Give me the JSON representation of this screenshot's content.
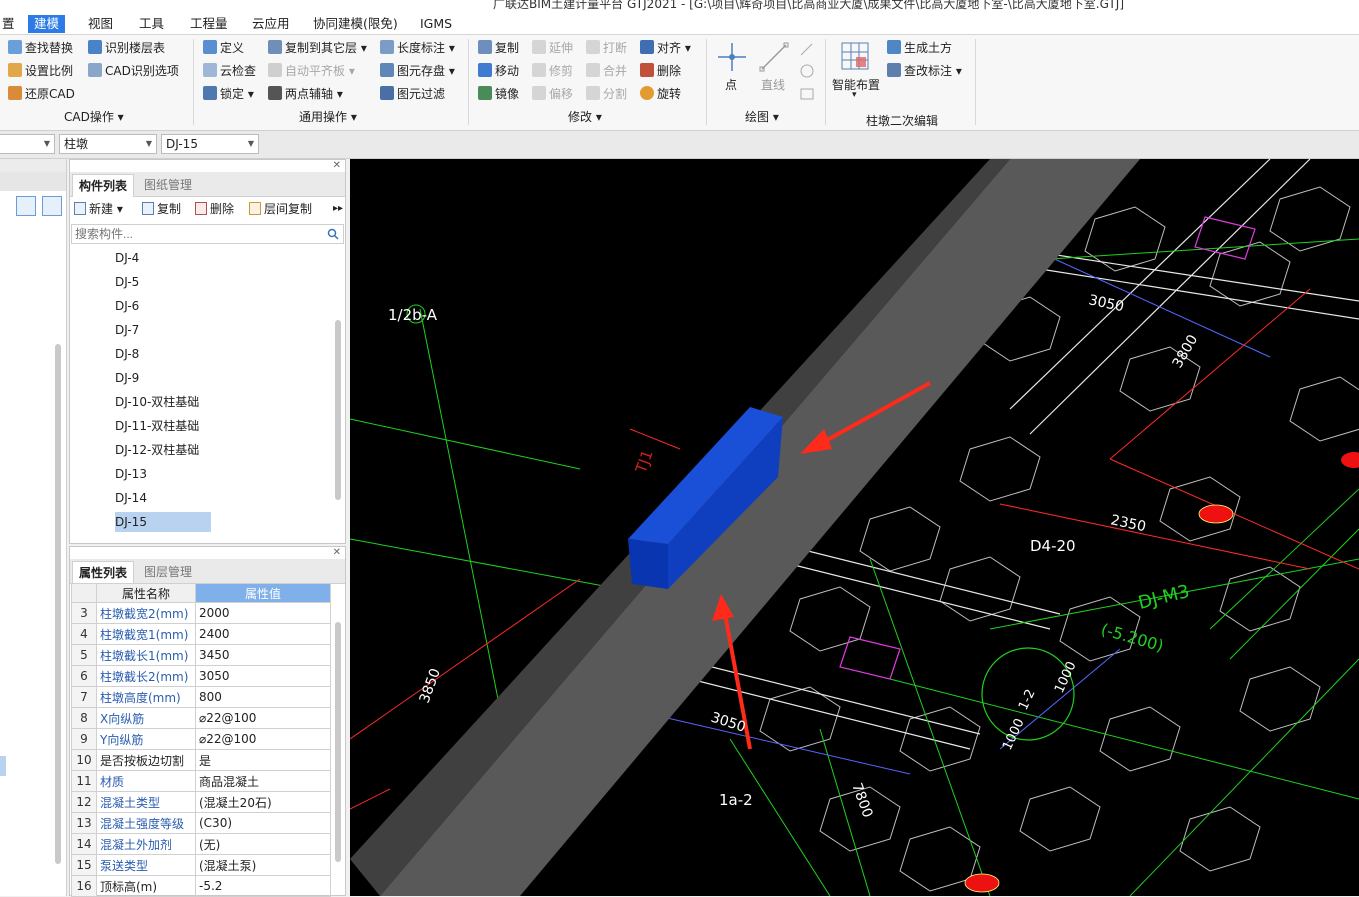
{
  "app": {
    "title": "广联达BIM土建计量平台 GTJ2021 - [G:\\项目\\辉奇项目\\比高商业大厦\\成果文件\\比高大厦地下室-\\比高大厦地下室.GTJ]"
  },
  "menu": [
    "置",
    "建模",
    "视图",
    "工具",
    "工程量",
    "云应用",
    "协同建模(限免)",
    "IGMS"
  ],
  "ribbon": {
    "cad_ops": {
      "label": "CAD操作",
      "items": [
        "查找替换",
        "识别楼层表",
        "设置比例",
        "CAD识别选项",
        "还原CAD"
      ]
    },
    "general_ops": {
      "label": "通用操作",
      "items": [
        "定义",
        "复制到其它层",
        "长度标注",
        "云检查",
        "自动平齐板",
        "图元存盘",
        "锁定",
        "两点辅轴",
        "图元过滤"
      ]
    },
    "modify": {
      "label": "修改",
      "items": [
        "复制",
        "延伸",
        "打断",
        "对齐",
        "移动",
        "修剪",
        "合并",
        "删除",
        "镜像",
        "偏移",
        "分割",
        "旋转"
      ]
    },
    "draw": {
      "label": "绘图",
      "items": [
        "点",
        "直线"
      ]
    },
    "pier_edit": {
      "label": "柱墩二次编辑",
      "items": [
        "智能布置",
        "生成土方",
        "查改标注"
      ]
    }
  },
  "combos": [
    "",
    "柱墩",
    "DJ-15"
  ],
  "component_panel": {
    "tabs": [
      "构件列表",
      "图纸管理"
    ],
    "toolbar": [
      "新建",
      "复制",
      "删除",
      "层间复制"
    ],
    "search_placeholder": "搜索构件...",
    "items": [
      "DJ-4",
      "DJ-5",
      "DJ-6",
      "DJ-7",
      "DJ-8",
      "DJ-9",
      "DJ-10-双柱基础",
      "DJ-11-双柱基础",
      "DJ-12-双柱基础",
      "DJ-13",
      "DJ-14",
      "DJ-15"
    ],
    "selected": "DJ-15"
  },
  "property_panel": {
    "tabs": [
      "属性列表",
      "图层管理"
    ],
    "headers": [
      "属性名称",
      "属性值"
    ],
    "rows": [
      {
        "idx": "3",
        "name": "柱墩截宽2(mm)",
        "value": "2000",
        "link": true
      },
      {
        "idx": "4",
        "name": "柱墩截宽1(mm)",
        "value": "2400",
        "link": true
      },
      {
        "idx": "5",
        "name": "柱墩截长1(mm)",
        "value": "3450",
        "link": true
      },
      {
        "idx": "6",
        "name": "柱墩截长2(mm)",
        "value": "3050",
        "link": true
      },
      {
        "idx": "7",
        "name": "柱墩高度(mm)",
        "value": "800",
        "link": true
      },
      {
        "idx": "8",
        "name": "X向纵筋",
        "value": "⌀22@100",
        "link": true
      },
      {
        "idx": "9",
        "name": "Y向纵筋",
        "value": "⌀22@100",
        "link": true
      },
      {
        "idx": "10",
        "name": "是否按板边切割",
        "value": "是",
        "link": false
      },
      {
        "idx": "11",
        "name": "材质",
        "value": "商品混凝土",
        "link": true
      },
      {
        "idx": "12",
        "name": "混凝土类型",
        "value": "(混凝土20石)",
        "link": true
      },
      {
        "idx": "13",
        "name": "混凝土强度等级",
        "value": "(C30)",
        "link": true
      },
      {
        "idx": "14",
        "name": "混凝土外加剂",
        "value": "(无)",
        "link": true
      },
      {
        "idx": "15",
        "name": "泵送类型",
        "value": "(混凝土泵)",
        "link": true
      },
      {
        "idx": "16",
        "name": "顶标高(m)",
        "value": "-5.2",
        "link": false
      }
    ]
  },
  "viewport": {
    "labels": {
      "axis_a": "1/2b-A",
      "axis_b": "1a-2",
      "d4": "D4-20",
      "dim_3050_top": "3050",
      "dim_3800": "3800",
      "dim_2350": "2350",
      "dim_3850": "3850",
      "dim_3050_bot": "3050",
      "dim_7800": "7800",
      "dim_1000a": "1000",
      "dim_1000b": "1000",
      "tag_12": "1-2",
      "dj_tag": "DJ-M3",
      "dj_elev": "(-5.200)",
      "tj": "TJ1"
    }
  }
}
